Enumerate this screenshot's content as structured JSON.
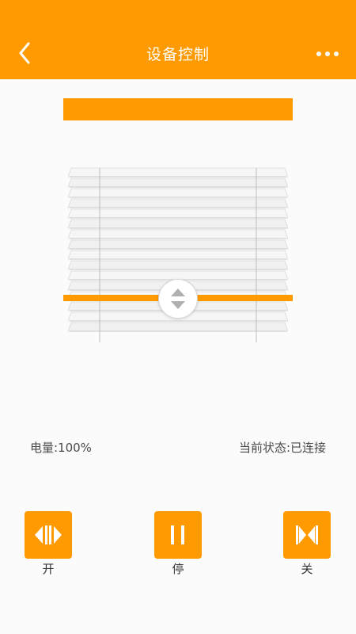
{
  "header": {
    "title": "设备控制"
  },
  "icons": {
    "back": "chevron-left-icon",
    "more": "more-dots-icon",
    "adjust": "up-down-arrows-icon",
    "open": "open-curtain-icon",
    "stop": "pause-icon",
    "close": "close-curtain-icon"
  },
  "colors": {
    "accent": "#ff9a00",
    "background": "#fbfbfb",
    "text": "#4a4a4a"
  },
  "info": {
    "battery": "电量:100%",
    "status": "当前状态:已连接"
  },
  "controls": {
    "open_label": "开",
    "stop_label": "停",
    "close_label": "关"
  }
}
